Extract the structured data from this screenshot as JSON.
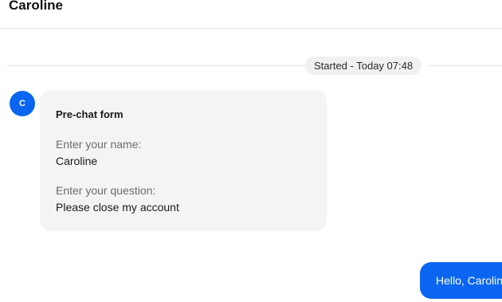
{
  "header": {
    "title": "Caroline"
  },
  "timeline": {
    "started_label": "Started - Today 07:48"
  },
  "avatar": {
    "initial": "C",
    "color": "#0a66f0"
  },
  "prechat_form": {
    "title": "Pre-chat form",
    "fields": [
      {
        "label": "Enter your name:",
        "value": "Caroline"
      },
      {
        "label": "Enter your question:",
        "value": "Please close my account"
      }
    ]
  },
  "agent_message": {
    "text": "Hello, Caroline"
  }
}
